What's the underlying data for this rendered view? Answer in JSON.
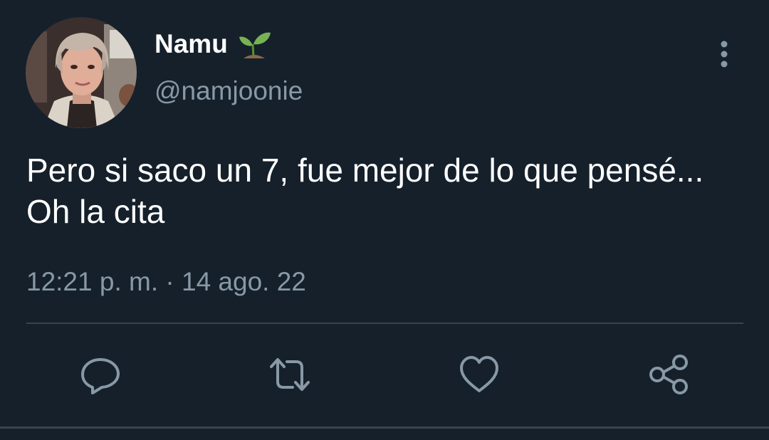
{
  "tweet": {
    "display_name": "Namu",
    "handle": "@namjoonie",
    "text": "Pero si saco un 7, fue mejor de lo que pensé... Oh la cita",
    "timestamp": "12:21 p. m. · 14 ago. 22"
  },
  "icons": {
    "badge": "seedling-icon",
    "menu": "more-vertical-icon",
    "actions": [
      "reply-icon",
      "retweet-icon",
      "like-icon",
      "share-icon"
    ]
  },
  "colors": {
    "background": "#15202b",
    "text_primary": "#ffffff",
    "text_secondary": "#8899a6",
    "divider": "#38444d"
  }
}
